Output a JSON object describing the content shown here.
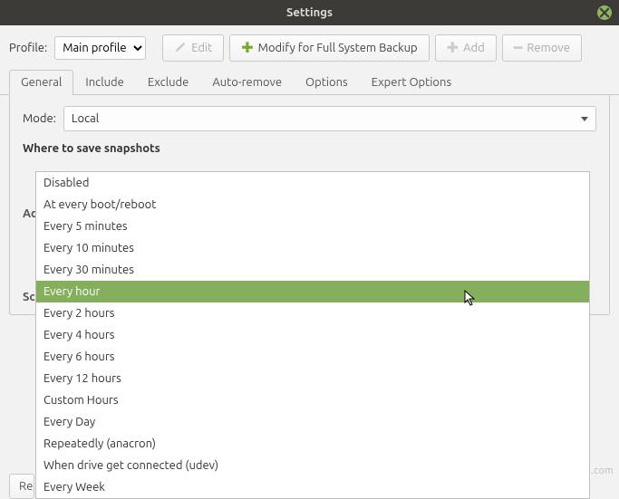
{
  "window": {
    "title": "Settings"
  },
  "toolbar": {
    "profile_label": "Profile:",
    "profile_value": "Main profile",
    "edit_label": "Edit",
    "modify_label": "Modify for Full System Backup",
    "add_label": "Add",
    "remove_label": "Remove"
  },
  "tabs": {
    "items": [
      {
        "label": "General",
        "active": true
      },
      {
        "label": "Include",
        "active": false
      },
      {
        "label": "Exclude",
        "active": false
      },
      {
        "label": "Auto-remove",
        "active": false
      },
      {
        "label": "Options",
        "active": false
      },
      {
        "label": "Expert Options",
        "active": false
      }
    ]
  },
  "content": {
    "mode_label": "Mode:",
    "mode_value": "Local",
    "where_label": "Where to save snapshots",
    "ad_partial": "Ad",
    "sc_partial": "Scl"
  },
  "dropdown": {
    "items": [
      "Disabled",
      "At every boot/reboot",
      "Every 5 minutes",
      "Every 10 minutes",
      "Every 30 minutes",
      "Every hour",
      "Every 2 hours",
      "Every 4 hours",
      "Every 6 hours",
      "Every 12 hours",
      "Custom Hours",
      "Every Day",
      "Repeatedly (anacron)",
      "When drive get connected (udev)",
      "Every Week"
    ],
    "selected_index": 5
  },
  "footer": {
    "res_partial": "Res"
  },
  "watermark": "wsxdn.com"
}
